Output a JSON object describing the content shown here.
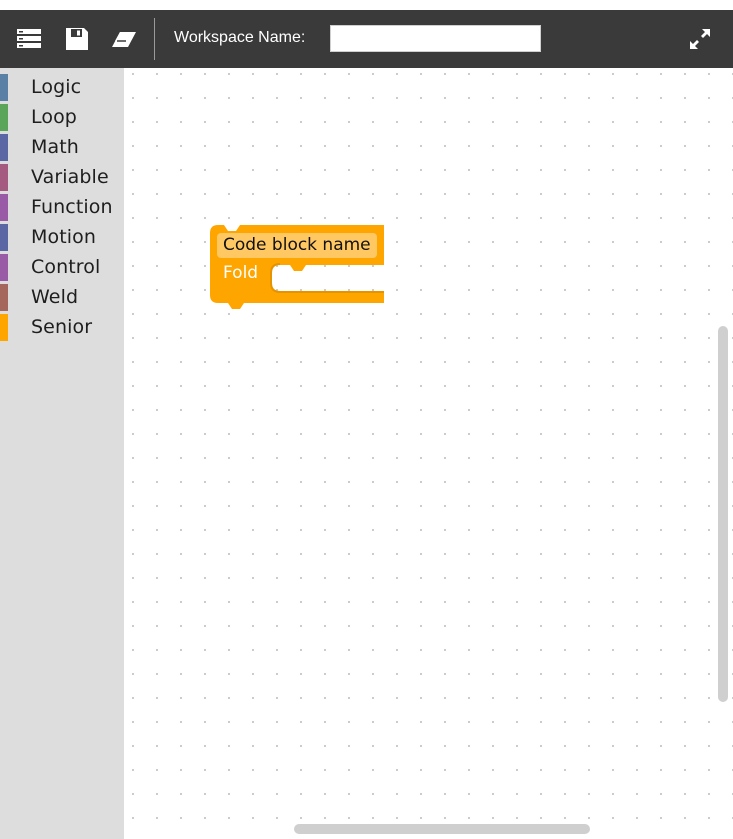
{
  "toolbar": {
    "workspace_label": "Workspace Name:",
    "workspace_value": "",
    "icons": [
      "list-icon",
      "save-icon",
      "eraser-icon",
      "expand-icon"
    ]
  },
  "sidebar": {
    "categories": [
      {
        "label": "Logic",
        "color": "#5b80a5"
      },
      {
        "label": "Loop",
        "color": "#5ba55b"
      },
      {
        "label": "Math",
        "color": "#5b67a5"
      },
      {
        "label": "Variable",
        "color": "#a55b80"
      },
      {
        "label": "Function",
        "color": "#995ba5"
      },
      {
        "label": "Motion",
        "color": "#5b67a5"
      },
      {
        "label": "Control",
        "color": "#995ba5"
      },
      {
        "label": "Weld",
        "color": "#a5675b"
      },
      {
        "label": "Senior",
        "color": "#ffa500"
      }
    ]
  },
  "workspace": {
    "block": {
      "name": "Code block name",
      "fold_label": "Fold",
      "color": "#ffa500"
    }
  }
}
